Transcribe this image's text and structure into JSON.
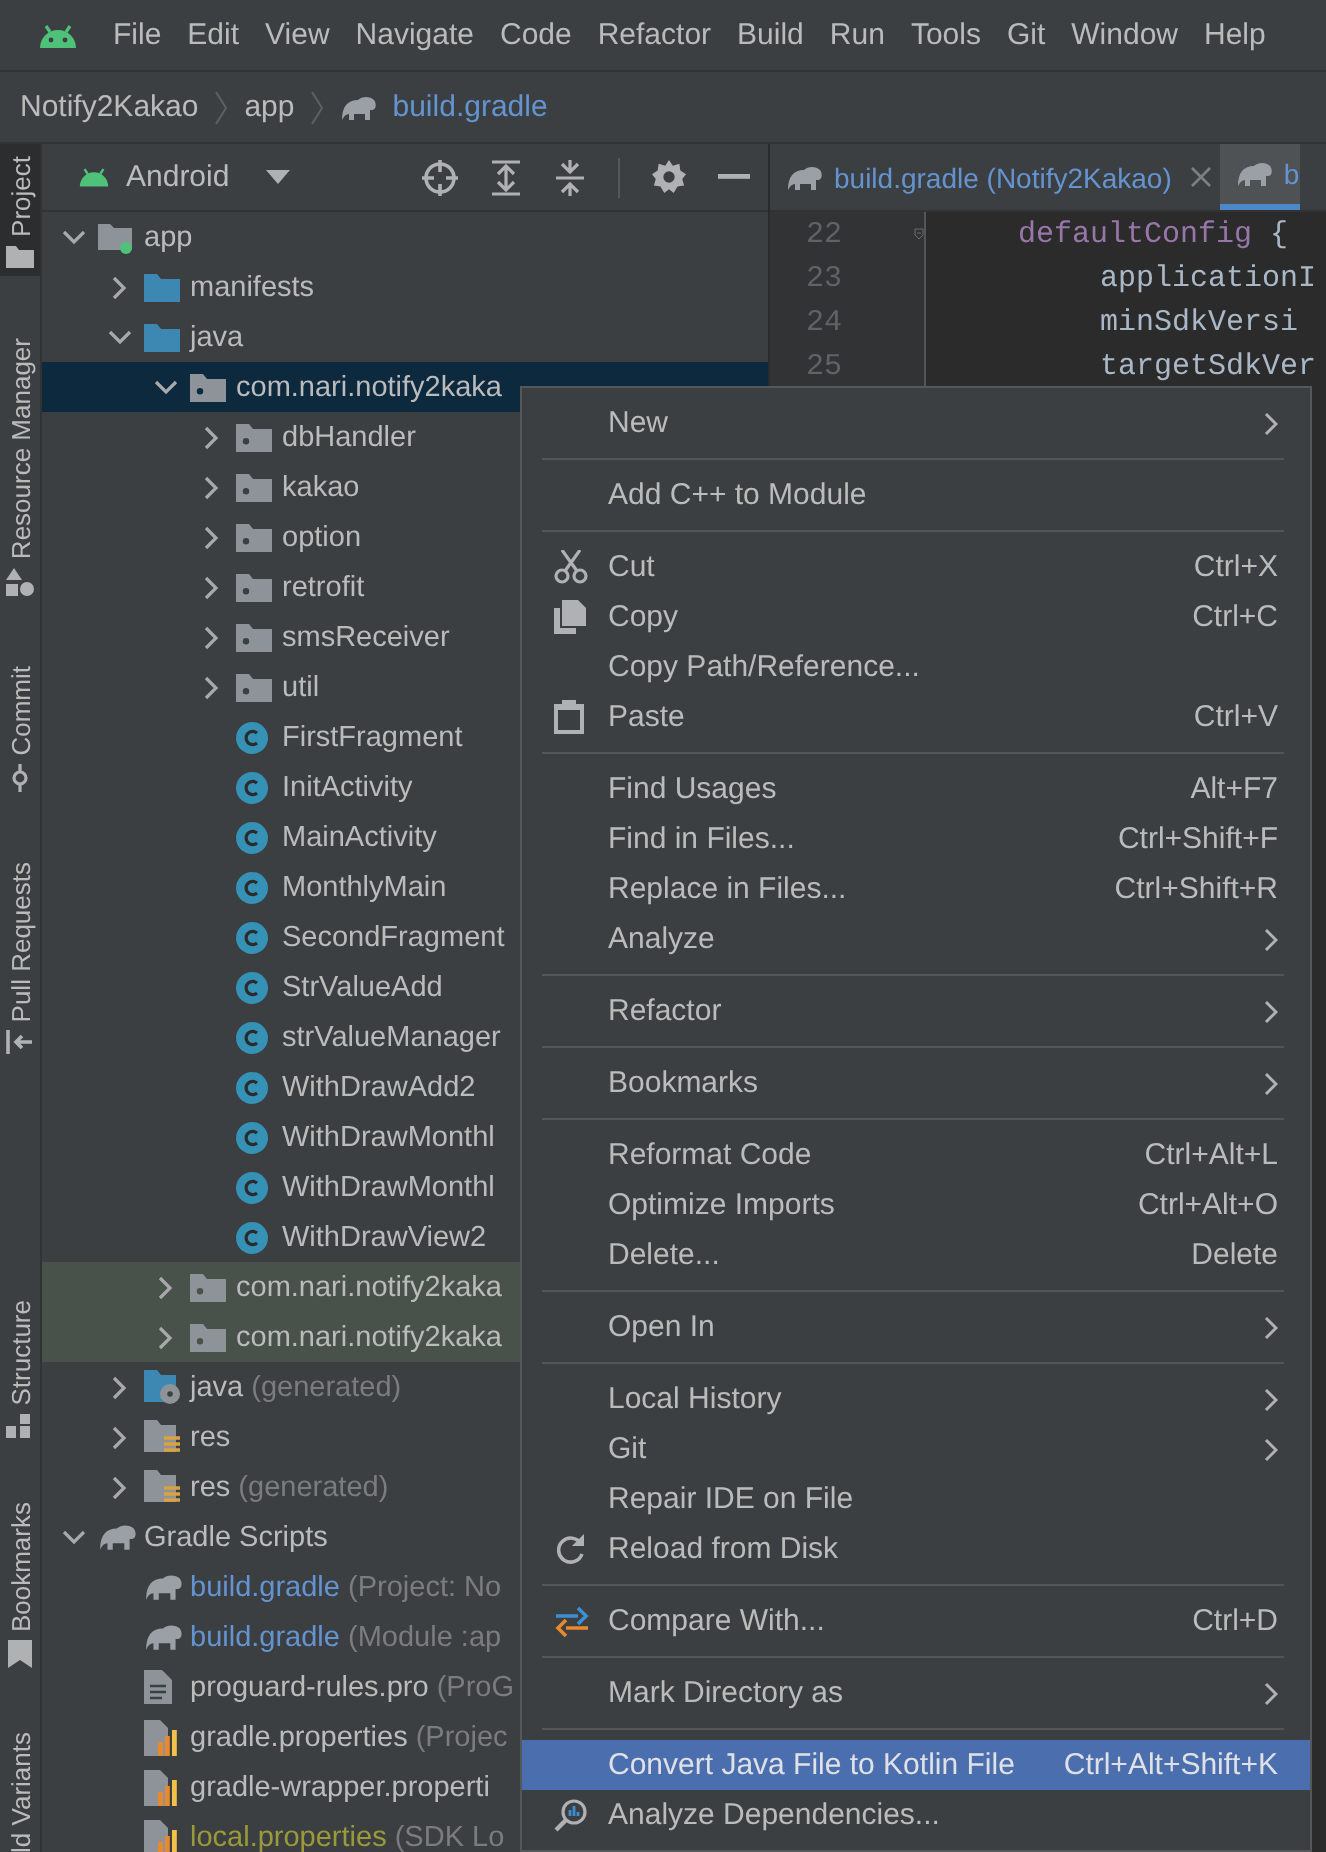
{
  "menu_bar": {
    "items": [
      "File",
      "Edit",
      "View",
      "Navigate",
      "Code",
      "Refactor",
      "Build",
      "Run",
      "Tools",
      "Git",
      "Window",
      "Help"
    ]
  },
  "breadcrumb": [
    {
      "label": "Notify2Kakao",
      "kind": "project"
    },
    {
      "label": "app",
      "kind": "module"
    },
    {
      "label": "build.gradle",
      "kind": "gradle"
    }
  ],
  "tool_window_stripe": {
    "top": [
      {
        "label": "Project",
        "selected": true
      },
      {
        "label": "Resource Manager",
        "selected": false
      },
      {
        "label": "Commit",
        "selected": false
      },
      {
        "label": "Pull Requests",
        "selected": false
      }
    ],
    "bottom": [
      {
        "label": "Structure",
        "selected": false
      },
      {
        "label": "Bookmarks",
        "selected": false
      },
      {
        "label": "ld Variants",
        "selected": false
      }
    ]
  },
  "project_panel": {
    "view": "Android",
    "tree": [
      {
        "label": "app",
        "kind": "module",
        "expanded": true,
        "selected": false,
        "children": [
          {
            "label": "manifests",
            "kind": "folder",
            "expanded": false,
            "selected": false
          },
          {
            "label": "java",
            "kind": "folder",
            "expanded": true,
            "selected": false,
            "children": [
              {
                "label": "com.nari.notify2kaka",
                "kind": "package",
                "expanded": true,
                "selected": true,
                "children": [
                  {
                    "label": "dbHandler",
                    "kind": "package",
                    "expanded": false,
                    "selected": false
                  },
                  {
                    "label": "kakao",
                    "kind": "package",
                    "expanded": false,
                    "selected": false
                  },
                  {
                    "label": "option",
                    "kind": "package",
                    "expanded": false,
                    "selected": false
                  },
                  {
                    "label": "retrofit",
                    "kind": "package",
                    "expanded": false,
                    "selected": false
                  },
                  {
                    "label": "smsReceiver",
                    "kind": "package",
                    "expanded": false,
                    "selected": false
                  },
                  {
                    "label": "util",
                    "kind": "package",
                    "expanded": false,
                    "selected": false
                  },
                  {
                    "label": "FirstFragment",
                    "kind": "class",
                    "selected": false
                  },
                  {
                    "label": "InitActivity",
                    "kind": "class",
                    "selected": false
                  },
                  {
                    "label": "MainActivity",
                    "kind": "class",
                    "selected": false
                  },
                  {
                    "label": "MonthlyMain",
                    "kind": "class",
                    "selected": false
                  },
                  {
                    "label": "SecondFragment",
                    "kind": "class",
                    "selected": false
                  },
                  {
                    "label": "StrValueAdd",
                    "kind": "class",
                    "selected": false
                  },
                  {
                    "label": "strValueManager",
                    "kind": "class",
                    "selected": false
                  },
                  {
                    "label": "WithDrawAdd2",
                    "kind": "class",
                    "selected": false
                  },
                  {
                    "label": "WithDrawMonthl",
                    "kind": "class",
                    "selected": false
                  },
                  {
                    "label": "WithDrawMonthl",
                    "kind": "class",
                    "selected": false
                  },
                  {
                    "label": "WithDrawView2",
                    "kind": "class",
                    "selected": false
                  }
                ]
              },
              {
                "label": "com.nari.notify2kaka",
                "kind": "package",
                "expanded": false,
                "selected": false,
                "test": true
              },
              {
                "label": "com.nari.notify2kaka",
                "kind": "package",
                "expanded": false,
                "selected": false,
                "test": true
              }
            ]
          },
          {
            "label": "java",
            "suffix": "(generated)",
            "kind": "generated",
            "expanded": false,
            "selected": false
          },
          {
            "label": "res",
            "kind": "res",
            "expanded": false,
            "selected": false
          },
          {
            "label": "res",
            "suffix": "(generated)",
            "kind": "res",
            "expanded": false,
            "selected": false
          }
        ]
      },
      {
        "label": "Gradle Scripts",
        "kind": "gradle",
        "expanded": true,
        "selected": false,
        "children": [
          {
            "label": "build.gradle",
            "suffix": "(Project: No",
            "kind": "gradle",
            "selected": false,
            "modified": true
          },
          {
            "label": "build.gradle",
            "suffix": "(Module :ap",
            "kind": "gradle",
            "selected": false,
            "modified": true
          },
          {
            "label": "proguard-rules.pro",
            "suffix": "(ProG",
            "kind": "file",
            "selected": false
          },
          {
            "label": "gradle.properties",
            "suffix": "(Projec",
            "kind": "properties",
            "selected": false
          },
          {
            "label": "gradle-wrapper.properti",
            "kind": "properties",
            "selected": false
          },
          {
            "label": "local.properties",
            "suffix": "(SDK Lo",
            "kind": "properties",
            "selected": false,
            "ignored": true
          }
        ]
      }
    ]
  },
  "editor": {
    "tabs": [
      {
        "label": "build.gradle (Notify2Kakao)",
        "selected": false,
        "closable": true
      },
      {
        "label": "b",
        "selected": true,
        "closable": false
      }
    ],
    "lines": [
      {
        "number": "22",
        "kind": "block",
        "fold": true,
        "tokens": [
          {
            "text": "defaultConfig",
            "kind": "method"
          },
          {
            "text": " {",
            "kind": "plain"
          }
        ]
      },
      {
        "number": "23",
        "kind": "statement",
        "fold": false,
        "tokens": [
          {
            "text": "applicationI",
            "kind": "plain"
          }
        ]
      },
      {
        "number": "24",
        "kind": "statement",
        "fold": false,
        "tokens": [
          {
            "text": "minSdkVersi",
            "kind": "plain"
          }
        ]
      },
      {
        "number": "25",
        "kind": "statement",
        "fold": false,
        "tokens": [
          {
            "text": "targetSdkVer",
            "kind": "plain"
          }
        ]
      }
    ]
  },
  "context_menu": {
    "items": [
      {
        "kind": "item",
        "label": "New",
        "submenu": true,
        "selected": false
      },
      {
        "kind": "separator"
      },
      {
        "kind": "item",
        "label": "Add C++ to Module",
        "submenu": false,
        "selected": false
      },
      {
        "kind": "separator"
      },
      {
        "kind": "item",
        "label": "Cut",
        "shortcut": "Ctrl+X",
        "submenu": false,
        "selected": false
      },
      {
        "kind": "item",
        "label": "Copy",
        "shortcut": "Ctrl+C",
        "submenu": false,
        "selected": false
      },
      {
        "kind": "item",
        "label": "Copy Path/Reference...",
        "submenu": false,
        "selected": false
      },
      {
        "kind": "item",
        "label": "Paste",
        "shortcut": "Ctrl+V",
        "submenu": false,
        "selected": false
      },
      {
        "kind": "separator"
      },
      {
        "kind": "item",
        "label": "Find Usages",
        "shortcut": "Alt+F7",
        "submenu": false,
        "selected": false
      },
      {
        "kind": "item",
        "label": "Find in Files...",
        "shortcut": "Ctrl+Shift+F",
        "submenu": false,
        "selected": false
      },
      {
        "kind": "item",
        "label": "Replace in Files...",
        "shortcut": "Ctrl+Shift+R",
        "submenu": false,
        "selected": false
      },
      {
        "kind": "item",
        "label": "Analyze",
        "submenu": true,
        "selected": false
      },
      {
        "kind": "separator"
      },
      {
        "kind": "item",
        "label": "Refactor",
        "submenu": true,
        "selected": false
      },
      {
        "kind": "separator"
      },
      {
        "kind": "item",
        "label": "Bookmarks",
        "submenu": true,
        "selected": false
      },
      {
        "kind": "separator"
      },
      {
        "kind": "item",
        "label": "Reformat Code",
        "shortcut": "Ctrl+Alt+L",
        "submenu": false,
        "selected": false
      },
      {
        "kind": "item",
        "label": "Optimize Imports",
        "shortcut": "Ctrl+Alt+O",
        "submenu": false,
        "selected": false
      },
      {
        "kind": "item",
        "label": "Delete...",
        "shortcut": "Delete",
        "submenu": false,
        "selected": false
      },
      {
        "kind": "separator"
      },
      {
        "kind": "item",
        "label": "Open In",
        "submenu": true,
        "selected": false
      },
      {
        "kind": "separator"
      },
      {
        "kind": "item",
        "label": "Local History",
        "submenu": true,
        "selected": false
      },
      {
        "kind": "item",
        "label": "Git",
        "submenu": true,
        "selected": false
      },
      {
        "kind": "item",
        "label": "Repair IDE on File",
        "submenu": false,
        "selected": false
      },
      {
        "kind": "item",
        "label": "Reload from Disk",
        "submenu": false,
        "selected": false
      },
      {
        "kind": "separator"
      },
      {
        "kind": "item",
        "label": "Compare With...",
        "shortcut": "Ctrl+D",
        "submenu": false,
        "selected": false
      },
      {
        "kind": "separator"
      },
      {
        "kind": "item",
        "label": "Mark Directory as",
        "submenu": true,
        "selected": false
      },
      {
        "kind": "separator"
      },
      {
        "kind": "item",
        "label": "Convert Java File to Kotlin File",
        "shortcut": "Ctrl+Alt+Shift+K",
        "submenu": false,
        "selected": true
      },
      {
        "kind": "item",
        "label": "Analyze Dependencies...",
        "submenu": false,
        "selected": false
      }
    ]
  }
}
